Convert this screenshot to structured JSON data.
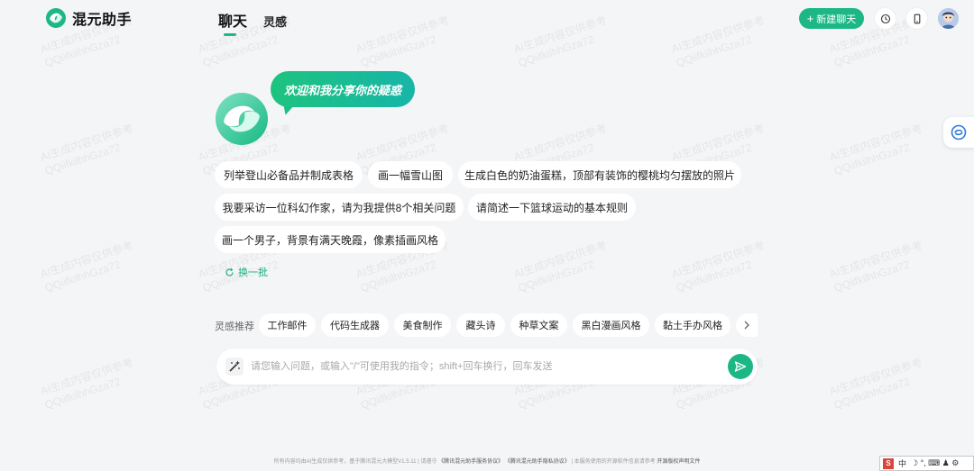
{
  "header": {
    "logo_text": "混元助手",
    "tabs": [
      {
        "label": "聊天",
        "active": true
      },
      {
        "label": "灵感",
        "active": false
      }
    ],
    "new_chat_label": "新建聊天",
    "icons": [
      "history-icon",
      "mobile-icon",
      "user-avatar"
    ]
  },
  "welcome": {
    "bubble_text": "欢迎和我分享你的疑惑"
  },
  "suggestions": [
    "列举登山必备品并制成表格",
    "画一幅雪山图",
    "生成白色的奶油蛋糕，顶部有装饰的樱桃均匀摆放的照片",
    "我要采访一位科幻作家，请为我提供8个相关问题",
    "请简述一下篮球运动的基本规则",
    "画一个男子，背景有满天晚霞，像素插画风格"
  ],
  "refresh_label": "换一批",
  "inspiration": {
    "label": "灵感推荐",
    "tags": [
      "工作邮件",
      "代码生成器",
      "美食制作",
      "藏头诗",
      "种草文案",
      "黑白漫画风格",
      "黏土手办风格"
    ]
  },
  "input": {
    "placeholder": "请您输入问题，或输入\"/\"可使用我的指令；shift+回车换行，回车发送",
    "value": ""
  },
  "watermark": {
    "line1": "AI生成内容仅供参考",
    "line2": "QQiifkilhhGza72"
  },
  "footer": {
    "text1": "所有内容均由AI生成仅供参考，基于腾讯混元大模型V1.5.11",
    "sep": "|",
    "text2": "请遵守",
    "link1": "《腾讯混元助手服务协议》",
    "link2": "《腾讯混元助手隐私协议》",
    "text3": "本服务使用的开源软件信息请参考",
    "link3": "开源版权声明文件"
  },
  "ime": {
    "lang": "中",
    "symbols": "☽ °, ⌨ ♟ ⚙"
  },
  "colors": {
    "accent": "#1cb784",
    "background": "#f4f5f7"
  }
}
